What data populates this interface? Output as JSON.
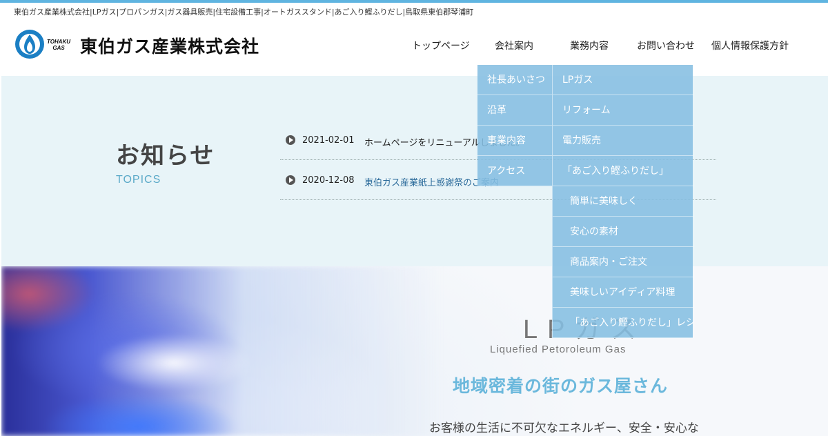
{
  "header": {
    "tagline": "東伯ガス産業株式会社|LPガス|プロパンガス|ガス器具販売|住宅設備工事|オートガススタンド|あご入り鰹ふりだし|鳥取県東伯郡琴浦町",
    "logo_sub_1": "TOHAKU",
    "logo_sub_2": "GAS",
    "company_name": "東伯ガス産業株式会社"
  },
  "nav": [
    {
      "label": "トップページ"
    },
    {
      "label": "会社案内"
    },
    {
      "label": "業務内容"
    },
    {
      "label": "お問い合わせ"
    },
    {
      "label": "個人情報保護方針"
    }
  ],
  "dropdown_company": [
    {
      "label": "社長あいさつ"
    },
    {
      "label": "沿革"
    },
    {
      "label": "事業内容"
    },
    {
      "label": "アクセス"
    }
  ],
  "dropdown_business": [
    {
      "label": "LPガス"
    },
    {
      "label": "リフォーム"
    },
    {
      "label": "電力販売"
    },
    {
      "label": "「あご入り鰹ふりだし」"
    },
    {
      "label": "簡単に美味しく"
    },
    {
      "label": "安心の素材"
    },
    {
      "label": "商品案内・ご注文"
    },
    {
      "label": "美味しいアイディア料理"
    },
    {
      "label": "「あご入り鰹ふりだし」レシピ"
    }
  ],
  "news": {
    "title": "お知らせ",
    "subtitle": "TOPICS",
    "items": [
      {
        "date": "2021-02-01",
        "text": "ホームページをリニューアルしました。"
      },
      {
        "date": "2020-12-08",
        "text": "東伯ガス産業紙上感謝祭のご案内"
      }
    ]
  },
  "hero": {
    "title": "LPガス",
    "subtitle_en": "Liquefied Petoroleum Gas",
    "heading": "地域密着の街のガス屋さん",
    "text": "お客様の生活に不可欠なエネルギー、安全・安心な"
  },
  "colors": {
    "accent": "#5fb4e0",
    "menu_bg": "#85bee1",
    "news_bg": "#e8f4f8",
    "hero_heading": "#6bb8dc"
  }
}
